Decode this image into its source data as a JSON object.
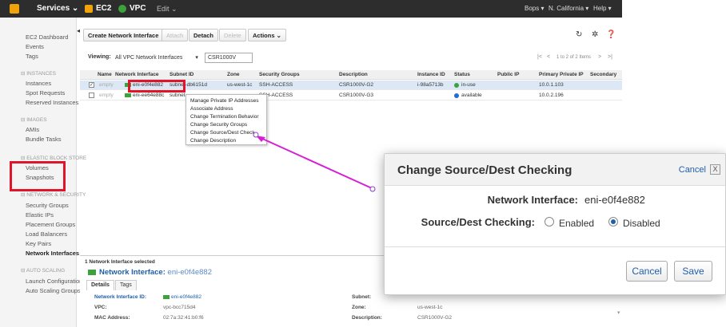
{
  "topbar": {
    "services": "Services ⌄",
    "ec2": "EC2",
    "vpc": "VPC",
    "edit": "Edit ⌄",
    "user": "Bops ▾",
    "region": "N. California ▾",
    "help": "Help ▾"
  },
  "sidebar": {
    "dashboard": "EC2 Dashboard",
    "events": "Events",
    "tags": "Tags",
    "instances_head": "⊟ INSTANCES",
    "instances": "Instances",
    "spot": "Spot Requests",
    "reserved": "Reserved Instances",
    "images_head": "⊟ IMAGES",
    "amis": "AMIs",
    "bundle": "Bundle Tasks",
    "ebs_head": "⊟ ELASTIC BLOCK STORE",
    "volumes": "Volumes",
    "snapshots": "Snapshots",
    "netsec_head": "⊟ NETWORK & SECURITY",
    "security_groups": "Security Groups",
    "elastic_ips": "Elastic IPs",
    "placement": "Placement Groups",
    "load_balancers": "Load Balancers",
    "key_pairs": "Key Pairs",
    "network_interfaces": "Network Interfaces",
    "autoscaling_head": "⊟ AUTO SCALING",
    "launch_configs": "Launch Configurations",
    "asg": "Auto Scaling Groups"
  },
  "toolbar": {
    "create": "Create Network Interface",
    "attach": "Attach",
    "detach": "Detach",
    "delete": "Delete",
    "actions": "Actions ⌄"
  },
  "filter": {
    "viewing_label": "Viewing:",
    "view_select": "All VPC Network Interfaces",
    "search_value": "CSR1000V",
    "pager_text": "1 to 2 of 2 Items"
  },
  "table": {
    "headers": [
      "Name",
      "Network Interface",
      "Subnet ID",
      "Zone",
      "Security Groups",
      "Description",
      "Instance ID",
      "Status",
      "Public IP",
      "Primary Private IP",
      "Secondary"
    ],
    "rows": [
      {
        "checked": "✓",
        "name": "empty",
        "eni": "eni-e0f4e882",
        "subnet": "subnet-db6151d",
        "zone": "us-west-1c",
        "sg": "SSH-ACCESS",
        "desc": "CSR1000V-G2",
        "instance": "i-98a5713b",
        "status": "in-use",
        "pubip": "",
        "privip": "10.0.1.103"
      },
      {
        "checked": "",
        "name": "empty",
        "eni": "eni-ee64e88c",
        "subnet": "subnet-",
        "zone": "",
        "sg": "SSH-ACCESS",
        "desc": "CSR1000V-G3",
        "instance": "",
        "status": "available",
        "pubip": "",
        "privip": "10.0.2.196"
      }
    ]
  },
  "context_menu": {
    "items": [
      "Manage Private IP Addresses",
      "Associate Address",
      "Change Termination Behavior",
      "Change Security Groups",
      "Change Source/Dest Check",
      "Change Description"
    ]
  },
  "details": {
    "selected_count": "1 Network Interface selected",
    "title_prefix": "Network Interface:",
    "title_value": "eni-e0f4e882",
    "tabs": [
      "Details",
      "Tags"
    ],
    "ni_id_label": "Network Interface ID:",
    "ni_id_value": "eni-e0f4e882",
    "vpc_label": "VPC:",
    "vpc_value": "vpc-bcc715d4",
    "mac_label": "MAC Address:",
    "mac_value": "02:7a:32:41:b0:f6",
    "subnet_label": "Subnet:",
    "zone_label": "Zone:",
    "zone_value": "us-west-1c",
    "desc_label": "Description:",
    "desc_value": "CSR1000V-G2"
  },
  "modal": {
    "title": "Change Source/Dest Checking",
    "cancel_top": "Cancel",
    "close": "X",
    "ni_label": "Network Interface:",
    "ni_value": "eni-e0f4e882",
    "sdc_label": "Source/Dest Checking:",
    "enabled": "Enabled",
    "disabled": "Disabled",
    "selected": "Disabled",
    "cancel_btn": "Cancel",
    "save_btn": "Save"
  },
  "colors": {
    "topbar": "#2d2d2d",
    "highlight": "#e0142b",
    "arrow": "#d61fd6",
    "link": "#1f5fa8",
    "status_in_use": "#3ca23c",
    "status_available": "#1f6fd1"
  }
}
